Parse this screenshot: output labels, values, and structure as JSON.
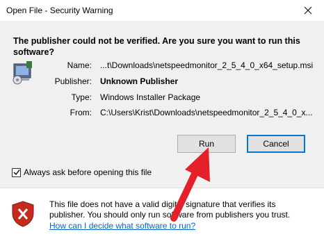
{
  "window": {
    "title": "Open File - Security Warning"
  },
  "heading": "The publisher could not be verified.  Are you sure you want to run this software?",
  "icons": {
    "package": "installer-package-icon",
    "close": "close-icon",
    "shield": "shield-error-icon",
    "check": "checkmark-icon"
  },
  "details": [
    {
      "label": "Name:",
      "value": "...t\\Downloads\\netspeedmonitor_2_5_4_0_x64_setup.msi",
      "bold": false
    },
    {
      "label": "Publisher:",
      "value": "Unknown Publisher",
      "bold": true
    },
    {
      "label": "Type:",
      "value": "Windows Installer Package",
      "bold": false
    },
    {
      "label": "From:",
      "value": "C:\\Users\\Krist\\Downloads\\netspeedmonitor_2_5_4_0_x...",
      "bold": false
    }
  ],
  "buttons": {
    "run": "Run",
    "cancel": "Cancel"
  },
  "checkbox": {
    "label": "Always ask before opening this file",
    "checked": true
  },
  "footer": {
    "text": "This file does not have a valid digital signature that verifies its publisher.  You should only run software from publishers you trust.",
    "link": "How can I decide what software to run?"
  },
  "colors": {
    "accent": "#0078d7",
    "link": "#0066cc",
    "arrow": "#e4202b",
    "shield": "#c42b1c"
  }
}
